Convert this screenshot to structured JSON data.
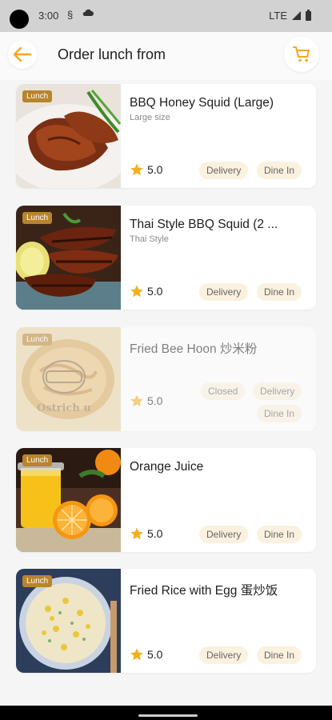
{
  "status": {
    "time": "3:00",
    "network": "LTE"
  },
  "header": {
    "title": "Order lunch from"
  },
  "icons": {
    "back": "arrow-left-icon",
    "cart": "cart-icon",
    "star": "star-icon",
    "accent": "#f5a623"
  },
  "colors": {
    "badge": "#b8842c",
    "tag_bg": "#fbf1df",
    "star": "#f2b01e"
  },
  "items": [
    {
      "name": "BBQ Honey Squid (Large)",
      "subtitle": "Large size",
      "badge": "Lunch",
      "rating": "5.0",
      "tags": [
        "Delivery",
        "Dine In"
      ]
    },
    {
      "name": "Thai Style BBQ Squid (2 ...",
      "subtitle": "Thai Style",
      "badge": "Lunch",
      "rating": "5.0",
      "tags": [
        "Delivery",
        "Dine In"
      ]
    },
    {
      "name": "Fried Bee Hoon 炒米粉",
      "subtitle": "",
      "badge": "Lunch",
      "rating": "5.0",
      "tags": [
        "Closed",
        "Delivery",
        "Dine In"
      ],
      "image_text": "Ostrich u"
    },
    {
      "name": "Orange Juice",
      "subtitle": "",
      "badge": "Lunch",
      "rating": "5.0",
      "tags": [
        "Delivery",
        "Dine In"
      ]
    },
    {
      "name": "Fried Rice with Egg 蛋炒饭",
      "subtitle": "",
      "badge": "Lunch",
      "rating": "5.0",
      "tags": [
        "Delivery",
        "Dine In"
      ]
    }
  ]
}
